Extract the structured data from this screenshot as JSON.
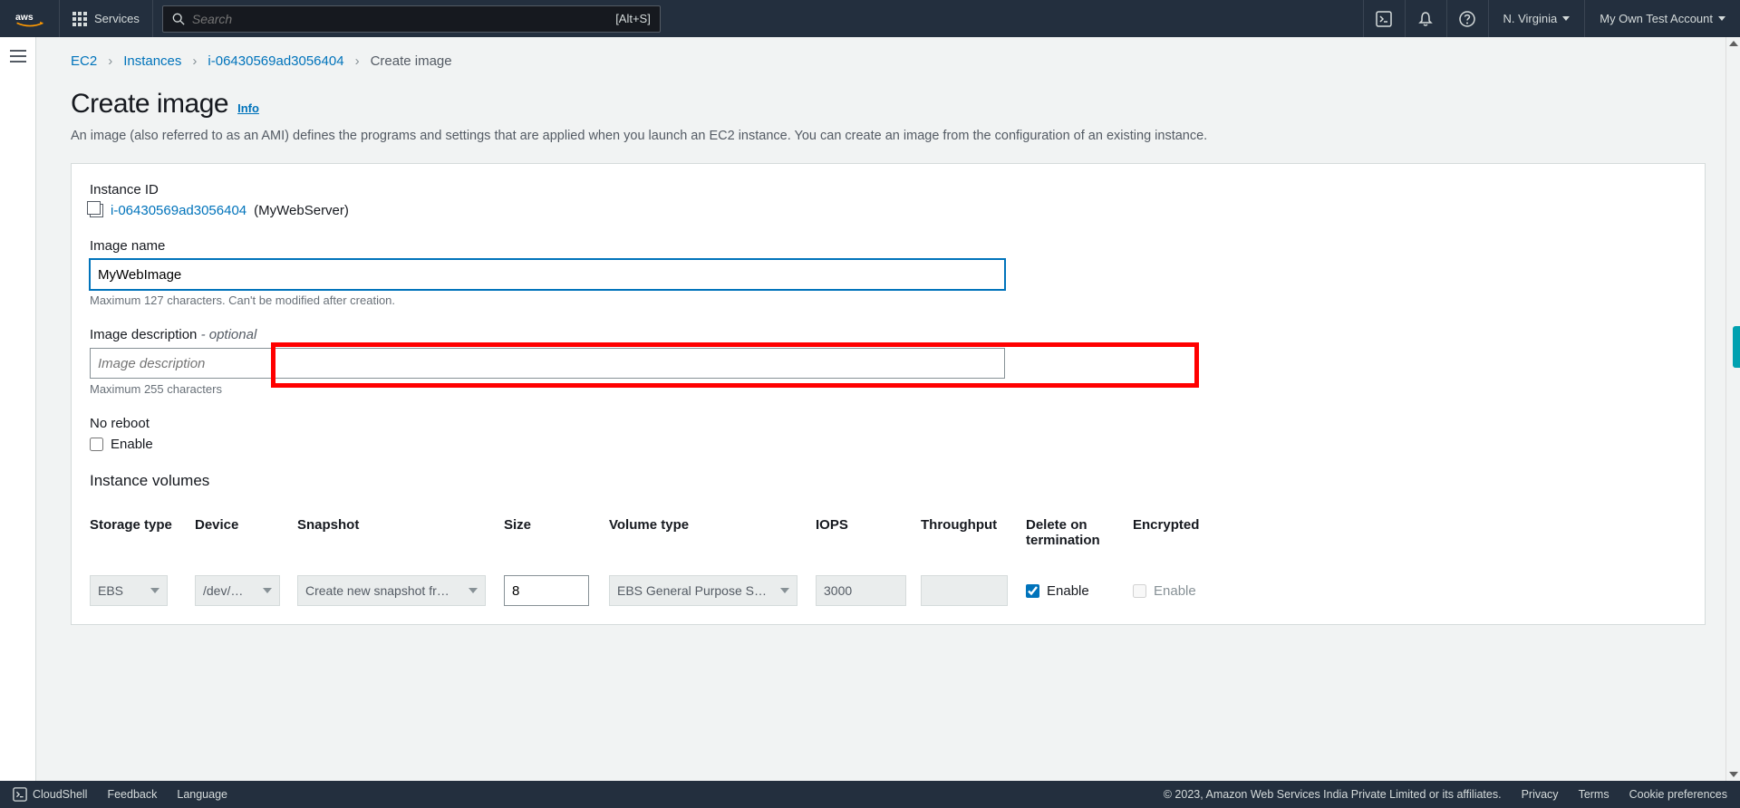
{
  "topnav": {
    "services_label": "Services",
    "search_placeholder": "Search",
    "search_shortcut": "[Alt+S]",
    "region": "N. Virginia",
    "account": "My Own Test Account"
  },
  "breadcrumbs": {
    "ec2": "EC2",
    "instances": "Instances",
    "instance_id": "i-06430569ad3056404",
    "current": "Create image"
  },
  "page": {
    "title": "Create image",
    "info": "Info",
    "description": "An image (also referred to as an AMI) defines the programs and settings that are applied when you launch an EC2 instance. You can create an image from the configuration of an existing instance."
  },
  "form": {
    "instance_id_label": "Instance ID",
    "instance_id_link": "i-06430569ad3056404",
    "instance_name_parenthetical": "(MyWebServer)",
    "image_name_label": "Image name",
    "image_name_value": "MyWebImage",
    "image_name_hint": "Maximum 127 characters. Can't be modified after creation.",
    "image_desc_label_main": "Image description",
    "image_desc_label_opt": " - optional",
    "image_desc_placeholder": "Image description",
    "image_desc_hint": "Maximum 255 characters",
    "no_reboot_label": "No reboot",
    "no_reboot_enable": "Enable",
    "volumes_label": "Instance volumes"
  },
  "volumes": {
    "headers": {
      "storage": "Storage type",
      "device": "Device",
      "snapshot": "Snapshot",
      "size": "Size",
      "voltype": "Volume type",
      "iops": "IOPS",
      "throughput": "Throughput",
      "delterm": "Delete on termination",
      "encrypted": "Encrypted"
    },
    "row": {
      "storage": "EBS",
      "device": "/dev/…",
      "snapshot": "Create new snapshot fr…",
      "size": "8",
      "voltype": "EBS General Purpose S…",
      "iops": "3000",
      "throughput": "",
      "delterm_label": "Enable",
      "enc_label": "Enable"
    }
  },
  "footer": {
    "cloudshell": "CloudShell",
    "feedback": "Feedback",
    "language": "Language",
    "copyright": "© 2023, Amazon Web Services India Private Limited or its affiliates.",
    "privacy": "Privacy",
    "terms": "Terms",
    "cookies": "Cookie preferences"
  }
}
